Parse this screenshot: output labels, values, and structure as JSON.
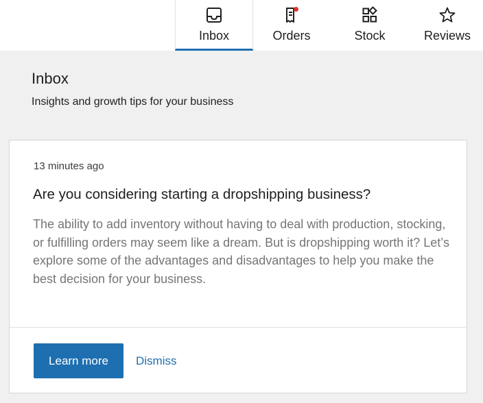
{
  "nav": {
    "tabs": [
      {
        "label": "Inbox",
        "icon": "inbox-icon",
        "active": true
      },
      {
        "label": "Orders",
        "icon": "orders-icon",
        "active": false,
        "notification_dot": true
      },
      {
        "label": "Stock",
        "icon": "stock-icon",
        "active": false
      },
      {
        "label": "Reviews",
        "icon": "star-icon",
        "active": false
      }
    ]
  },
  "page": {
    "title": "Inbox",
    "subtitle": "Insights and growth tips for your business"
  },
  "note": {
    "time": "13 minutes ago",
    "title": "Are you considering starting a dropshipping business?",
    "body": "The ability to add inventory without having to deal with production, stocking, or fulfilling orders may seem like a dream. But is dropshipping worth it? Let’s explore some of the advantages and disadvantages to help you make the best decision for your business.",
    "primary_action": "Learn more",
    "secondary_action": "Dismiss"
  },
  "colors": {
    "accent": "#1e6fb0",
    "notification": "#e0322f",
    "background": "#f0f0f1"
  }
}
